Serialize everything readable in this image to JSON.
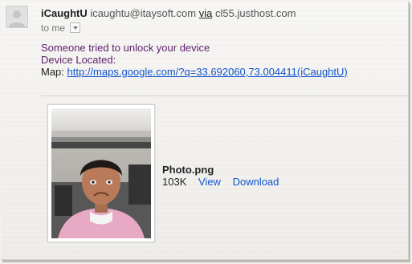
{
  "email": {
    "sender_name": "iCaughtU",
    "sender_email": "icaughtu@itaysoft.com",
    "via_label": "via",
    "via_host": "cl55.justhost.com",
    "to_label": "to me",
    "body_line1": "Someone tried to unlock your device",
    "body_line2": "Device Located:",
    "map_label": "Map:",
    "map_url": "http://maps.google.com/?q=33.692060,73.004411(iCaughtU)"
  },
  "attachment": {
    "file_name": "Photo.png",
    "file_size": "103K",
    "view_label": "View",
    "download_label": "Download"
  },
  "icons": {
    "avatar": "default-avatar-icon",
    "dropdown": "chevron-down-icon"
  }
}
